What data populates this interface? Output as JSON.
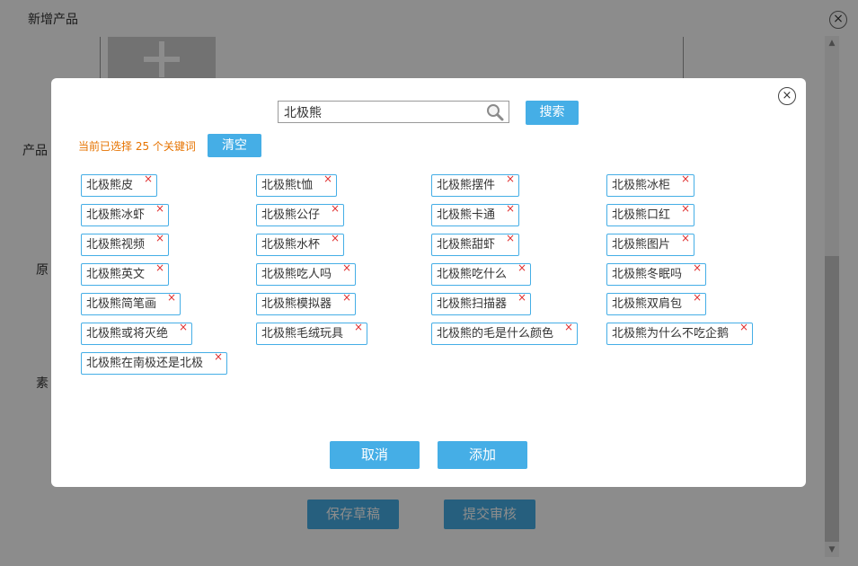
{
  "background": {
    "title": "新增产品",
    "labels": [
      "产品",
      "原",
      "素"
    ],
    "buttons": {
      "save_draft": "保存草稿",
      "submit_review": "提交审核"
    }
  },
  "modal": {
    "search": {
      "value": "北极熊",
      "button_label": "搜索"
    },
    "selected_info": "当前已选择 25 个关键词",
    "clear_label": "清空",
    "tags": [
      "北极熊皮",
      "北极熊t恤",
      "北极熊摆件",
      "北极熊冰柜",
      "北极熊冰虾",
      "北极熊公仔",
      "北极熊卡通",
      "北极熊口红",
      "北极熊视频",
      "北极熊水杯",
      "北极熊甜虾",
      "北极熊图片",
      "北极熊英文",
      "北极熊吃人吗",
      "北极熊吃什么",
      "北极熊冬眠吗",
      "北极熊简笔画",
      "北极熊模拟器",
      "北极熊扫描器",
      "北极熊双肩包",
      "北极熊或将灭绝",
      "北极熊毛绒玩具",
      "北极熊的毛是什么颜色",
      "北极熊为什么不吃企鹅",
      "北极熊在南极还是北极"
    ],
    "tag_remove_glyph": "×",
    "cancel_label": "取消",
    "add_label": "添加"
  },
  "icons": {
    "close": "close-circle-icon",
    "search": "magnifier-icon",
    "remove": "remove-x-icon"
  },
  "colors": {
    "accent": "#45aee6",
    "warning_text": "#e67300",
    "remove_x": "#e03030"
  }
}
